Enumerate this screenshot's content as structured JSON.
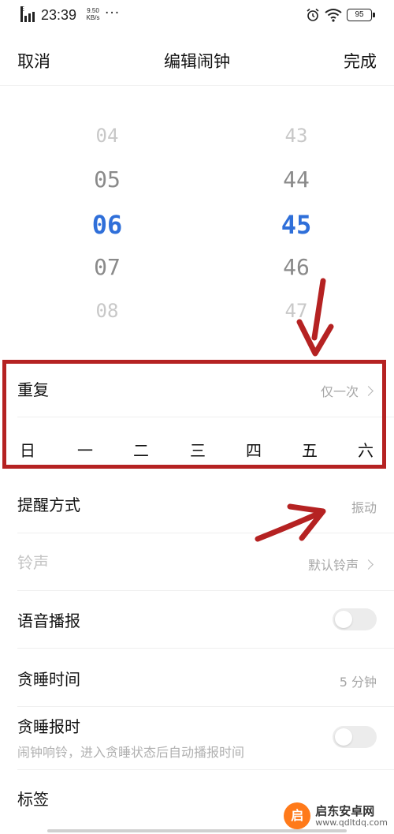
{
  "status_bar": {
    "network": "E",
    "time": "23:39",
    "speed_value": "9.50",
    "speed_unit": "KB/s",
    "more": "···",
    "battery": "95"
  },
  "header": {
    "cancel_label": "取消",
    "title": "编辑闹钟",
    "done_label": "完成"
  },
  "picker": {
    "hours": [
      "04",
      "05",
      "06",
      "07",
      "08"
    ],
    "minutes": [
      "43",
      "44",
      "45",
      "46",
      "47"
    ],
    "selected_hour": "06",
    "selected_minute": "45",
    "accent_color": "#2f6fd9"
  },
  "repeat": {
    "label": "重复",
    "value": "仅一次",
    "days": [
      "日",
      "一",
      "二",
      "三",
      "四",
      "五",
      "六"
    ]
  },
  "reminder": {
    "label": "提醒方式",
    "value": "振动"
  },
  "ringtone": {
    "label": "铃声",
    "value": "默认铃声"
  },
  "voice_broadcast": {
    "label": "语音播报",
    "enabled": false
  },
  "snooze_time": {
    "label": "贪睡时间",
    "value": "5 分钟"
  },
  "snooze_broadcast": {
    "label": "贪睡报时",
    "description": "闹钟响铃，进入贪睡状态后自动播报时间",
    "enabled": false
  },
  "tag": {
    "label": "标签"
  },
  "annotation": {
    "box_color": "#b52222"
  },
  "watermark": {
    "logo_char": "启",
    "title": "启东安卓网",
    "url": "www.qdltdq.com"
  }
}
